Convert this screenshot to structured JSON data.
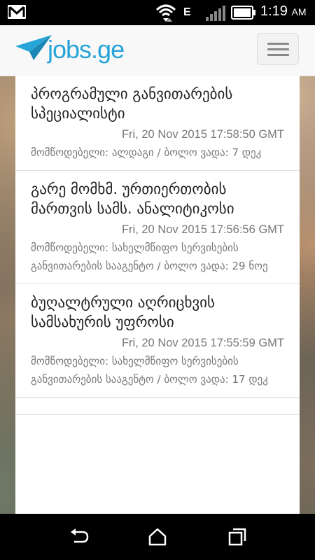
{
  "status_bar": {
    "network": "E",
    "time": "1:19",
    "ampm": "AM",
    "icons": [
      "gmail-icon",
      "wifi-icon",
      "signal-icon",
      "battery-icon"
    ]
  },
  "header": {
    "logo_text": "jobs.ge",
    "menu_icon": "hamburger-menu-icon"
  },
  "jobs": [
    {
      "title": "პროგრამული განვითარების სპეციალისტი",
      "date": "Fri, 20 Nov 2015 17:58:50 GMT",
      "meta": "მომწოდებელი: ალდაგი / ბოლო ვადა: 7 დეკ"
    },
    {
      "title": "გარე მომხმ. ურთიერთობის მართვის სამს. ანალიტიკოსი",
      "date": "Fri, 20 Nov 2015 17:56:56 GMT",
      "meta": "მომწოდებელი: სახელმწიფო სერვისების განვითარების სააგენტო / ბოლო ვადა: 29 ნოე"
    },
    {
      "title": "ბუღალტრული აღრიცხვის სამსახურის უფროსი",
      "date": "Fri, 20 Nov 2015 17:55:59 GMT",
      "meta": "მომწოდებელი: სახელმწიფო სერვისების განვითარების სააგენტო / ბოლო ვადა: 17 დეკ"
    },
    {
      "title": "",
      "date": "",
      "meta": ""
    }
  ],
  "nav_bar": {
    "buttons": [
      "back-icon",
      "home-icon",
      "recents-icon"
    ]
  },
  "colors": {
    "brand": "#27a5d8",
    "text": "#222222",
    "muted": "#777777"
  }
}
